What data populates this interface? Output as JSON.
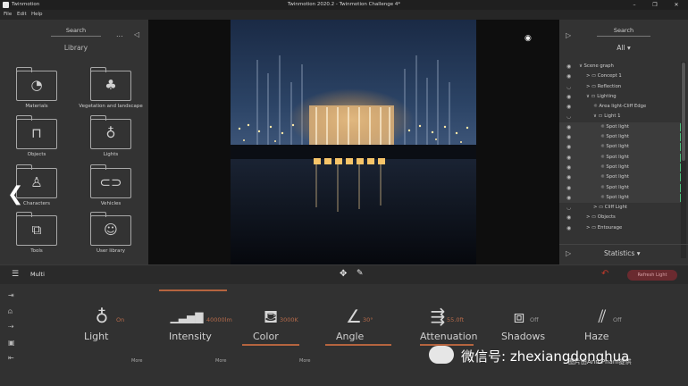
{
  "window": {
    "app_name": "Twinmotion",
    "title": "Twinmotion 2020.2 - Twinmotion Challenge 4*",
    "controls": [
      "–",
      "❐",
      "✕"
    ]
  },
  "menu": [
    "File",
    "Edit",
    "Help"
  ],
  "library_panel": {
    "search_label": "Search",
    "title": "Library",
    "more": "...",
    "items": [
      {
        "label": "Materials",
        "icon": "materials-icon",
        "glyph": "◔"
      },
      {
        "label": "Vegetation and landscape",
        "icon": "tree-icon",
        "glyph": "♣"
      },
      {
        "label": "Objects",
        "icon": "sofa-icon",
        "glyph": "⊓"
      },
      {
        "label": "Lights",
        "icon": "lightbulb-icon",
        "glyph": "♁"
      },
      {
        "label": "Characters",
        "icon": "person-icon",
        "glyph": "♙"
      },
      {
        "label": "Vehicles",
        "icon": "car-icon",
        "glyph": "⊂⊃"
      },
      {
        "label": "Tools",
        "icon": "cubes-icon",
        "glyph": "⧉"
      },
      {
        "label": "User library",
        "icon": "user-icon",
        "glyph": "☺"
      }
    ]
  },
  "scene_panel": {
    "search_label": "Search",
    "filter": "All",
    "tree": [
      {
        "label": "Scene graph",
        "indent": 0,
        "arrow": "∨",
        "folder": false,
        "selected": false,
        "eye": true
      },
      {
        "label": "Concept 1",
        "indent": 1,
        "arrow": ">",
        "folder": true,
        "selected": false,
        "eye": true
      },
      {
        "label": "Reflection",
        "indent": 1,
        "arrow": ">",
        "folder": true,
        "selected": false,
        "eye": false
      },
      {
        "label": "Lighting",
        "indent": 1,
        "arrow": "∨",
        "folder": true,
        "selected": false,
        "eye": true
      },
      {
        "label": "Area light-Cliff Edge",
        "indent": 2,
        "arrow": "",
        "folder": false,
        "selected": false,
        "eye": true
      },
      {
        "label": "Light 1",
        "indent": 2,
        "arrow": "∨",
        "folder": true,
        "selected": false,
        "eye": false
      },
      {
        "label": "Spot light",
        "indent": 3,
        "arrow": "",
        "folder": false,
        "selected": true,
        "eye": true
      },
      {
        "label": "Spot light",
        "indent": 3,
        "arrow": "",
        "folder": false,
        "selected": true,
        "eye": true
      },
      {
        "label": "Spot light",
        "indent": 3,
        "arrow": "",
        "folder": false,
        "selected": true,
        "eye": true
      },
      {
        "label": "Spot light",
        "indent": 3,
        "arrow": "",
        "folder": false,
        "selected": true,
        "eye": true
      },
      {
        "label": "Spot light",
        "indent": 3,
        "arrow": "",
        "folder": false,
        "selected": true,
        "eye": true
      },
      {
        "label": "Spot light",
        "indent": 3,
        "arrow": "",
        "folder": false,
        "selected": true,
        "eye": true
      },
      {
        "label": "Spot light",
        "indent": 3,
        "arrow": "",
        "folder": false,
        "selected": true,
        "eye": true
      },
      {
        "label": "Spot light",
        "indent": 3,
        "arrow": "",
        "folder": false,
        "selected": true,
        "eye": true
      },
      {
        "label": "Cliff Light",
        "indent": 2,
        "arrow": ">",
        "folder": true,
        "selected": false,
        "eye": false
      },
      {
        "label": "Objects",
        "indent": 1,
        "arrow": ">",
        "folder": true,
        "selected": false,
        "eye": true
      },
      {
        "label": "Entourage",
        "indent": 1,
        "arrow": ">",
        "folder": true,
        "selected": false,
        "eye": true
      }
    ],
    "statistics_label": "Statistics"
  },
  "toolbar": {
    "mode_label": "Multi",
    "refresh_label": "Refresh Light"
  },
  "properties": [
    {
      "label": "Light",
      "value": "On",
      "icon": "bulb-icon",
      "glyph": "♁",
      "more": "More",
      "active": false
    },
    {
      "label": "Intensity",
      "value": "40000lm",
      "icon": "bars-icon",
      "glyph": "▁▃▅▇",
      "more": "More",
      "active": true
    },
    {
      "label": "Color",
      "value": "3000K",
      "icon": "paint-bucket-icon",
      "glyph": "⛾",
      "more": "More",
      "active": true
    },
    {
      "label": "Angle",
      "value": "30°",
      "icon": "angle-icon",
      "glyph": "∠",
      "more": "",
      "active": true
    },
    {
      "label": "Attenuation",
      "value": "55.0ft",
      "icon": "attenuation-icon",
      "glyph": "⇶",
      "more": "",
      "active": true
    },
    {
      "label": "Shadows",
      "value": "Off",
      "icon": "cube-icon",
      "glyph": "⧈",
      "more": "",
      "active": false
    },
    {
      "label": "Haze",
      "value": "Off",
      "icon": "haze-icon",
      "glyph": "⫽",
      "more": "",
      "active": false
    }
  ],
  "watermark": {
    "main": "微信号: zhexiangdonghua",
    "sub": "图片由Ann Pham提供"
  }
}
